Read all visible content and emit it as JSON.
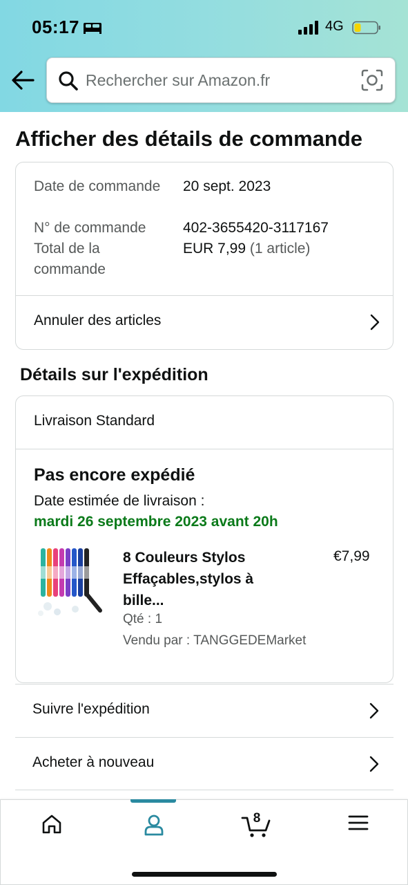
{
  "status_bar": {
    "time": "05:17",
    "network": "4G"
  },
  "search": {
    "placeholder": "Rechercher sur Amazon.fr"
  },
  "page": {
    "title": "Afficher des détails de commande"
  },
  "order": {
    "date_label": "Date de commande",
    "date_value": "20 sept. 2023",
    "number_label": "N° de commande",
    "number_value": "402-3655420-3117167",
    "total_label": "Total de la commande",
    "total_value": "EUR 7,99",
    "total_count": "(1 article)",
    "cancel_label": "Annuler des articles"
  },
  "shipping": {
    "section_title": "Détails sur l'expédition",
    "method": "Livraison Standard",
    "status": "Pas encore expédié",
    "estimate_label": "Date estimée de livraison :",
    "estimate_date": "mardi 26 septembre 2023 avant 20h",
    "product": {
      "title": "8 Couleurs Stylos Effaçables,stylos à bille...",
      "price": "€7,99",
      "qty": "Qté : 1",
      "seller": "Vendu par : TANGGEDEMarket"
    }
  },
  "actions": [
    {
      "label": "Suivre l'expédition"
    },
    {
      "label": "Acheter à nouveau"
    }
  ],
  "nav": {
    "items": [
      "home-icon",
      "account-icon",
      "cart-icon",
      "menu-icon"
    ],
    "cart_count": "8",
    "active": "account-icon",
    "accent_color": "#2a8aa0"
  },
  "colors": {
    "delivery_green": "#0b7a1a",
    "text": "#0f1111",
    "muted": "#565959"
  }
}
